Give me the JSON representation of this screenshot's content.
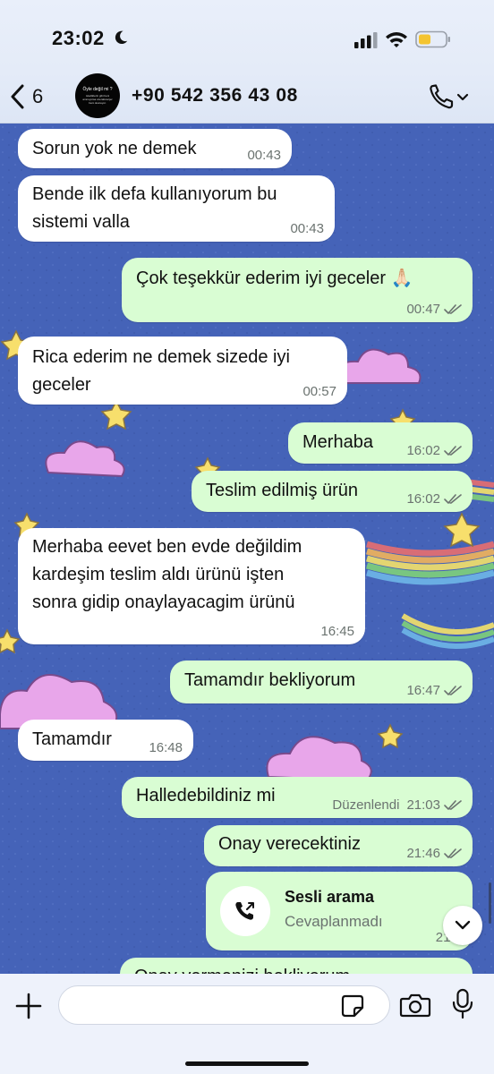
{
  "status": {
    "time": "23:02"
  },
  "header": {
    "back_count": "6",
    "contact": "+90 542 356 43 08",
    "avatar_line1": "Öyle değil mi ?",
    "avatar_line2": "istediklerin gibi beni amnuyorsa ozeraferenjer beni okunuyor."
  },
  "messages": [
    {
      "dir": "in",
      "text": "Sorun yok ne demek",
      "time": "00:43"
    },
    {
      "dir": "in",
      "text": "Bende ilk defa kullanıyorum bu\nsistemi valla",
      "time": "00:43"
    },
    {
      "dir": "out",
      "text": "Çok teşekkür ederim iyi geceler 🙏🏻",
      "time": "00:47",
      "read": true
    },
    {
      "dir": "in",
      "text": "Rica ederim ne demek sizede iyi\ngeceler",
      "time": "00:57"
    },
    {
      "dir": "out",
      "text": "Merhaba",
      "time": "16:02",
      "read": true
    },
    {
      "dir": "out",
      "text": "Teslim edilmiş ürün",
      "time": "16:02",
      "read": true
    },
    {
      "dir": "in",
      "text": "Merhaba eevet ben evde değildim\nkardeşim teslim aldı ürünü işten\nsonra gidip onaylayacagim ürünü",
      "time": "16:45"
    },
    {
      "dir": "out",
      "text": "Tamamdır bekliyorum",
      "time": "16:47",
      "read": true
    },
    {
      "dir": "in",
      "text": "Tamamdır",
      "time": "16:48"
    },
    {
      "dir": "out",
      "text": "Halledebildiniz mi",
      "time": "21:03",
      "edited": "Düzenlendi",
      "read": true
    },
    {
      "dir": "out",
      "text": "Onay verecektiniz",
      "time": "21:46",
      "read": true
    }
  ],
  "call_message": {
    "title": "Sesli arama",
    "subtitle": "Cevaplanmadı",
    "time": "21:5"
  },
  "partial_message": "Onay vermenizi bekliyorum",
  "composer": {
    "placeholder": ""
  },
  "colors": {
    "incoming": "#ffffff",
    "outgoing": "#d9fdd3",
    "wallpaper": "#4563b8",
    "ticks": "#6b7370"
  },
  "icons": [
    "moon-icon",
    "signal-icon",
    "wifi-icon",
    "battery-icon",
    "back-chevron-icon",
    "phone-icon",
    "chevron-down-icon",
    "double-check-icon",
    "outgoing-call-icon",
    "plus-icon",
    "sticker-icon",
    "camera-icon",
    "mic-icon"
  ]
}
